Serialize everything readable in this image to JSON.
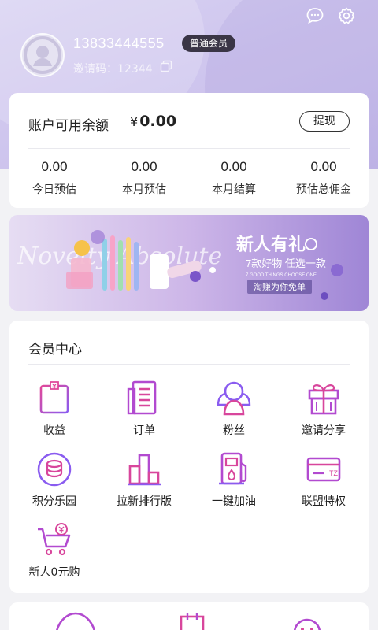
{
  "header": {
    "phone": "13833444555",
    "member_level": "普通会员",
    "invite_code": "邀请码：12344",
    "icons": [
      "chat-icon",
      "gear-icon",
      "copy-icon"
    ]
  },
  "balance": {
    "label": "账户可用余额",
    "currency": "¥",
    "amount": "0.00",
    "withdraw_label": "提现",
    "stats": [
      {
        "value": "0.00",
        "label": "今日预估"
      },
      {
        "value": "0.00",
        "label": "本月预估"
      },
      {
        "value": "0.00",
        "label": "本月结算"
      },
      {
        "value": "0.00",
        "label": "预估总佣金"
      }
    ]
  },
  "banner": {
    "headline": "新人有礼",
    "sub": "7款好物 任选一款",
    "sub_en": "7 GOOD THINGS CHOOSE ONE",
    "cta": "淘赚为你免单",
    "script_text": "Novelty Absolute"
  },
  "member_center": {
    "title": "会员中心",
    "items": [
      {
        "label": "收益",
        "icon": "earnings-icon"
      },
      {
        "label": "订单",
        "icon": "order-icon"
      },
      {
        "label": "粉丝",
        "icon": "fans-icon"
      },
      {
        "label": "邀请分享",
        "icon": "gift-icon"
      },
      {
        "label": "积分乐园",
        "icon": "coins-icon"
      },
      {
        "label": "拉新排行版",
        "icon": "ranking-icon"
      },
      {
        "label": "一键加油",
        "icon": "fuel-icon"
      },
      {
        "label": "联盟特权",
        "icon": "card-icon"
      },
      {
        "label": "新人0元购",
        "icon": "cart-icon"
      }
    ]
  },
  "colors": {
    "accent_purple": "#8a5cf0",
    "accent_pink": "#e0489a",
    "header_bg": "#cfc6ee"
  }
}
